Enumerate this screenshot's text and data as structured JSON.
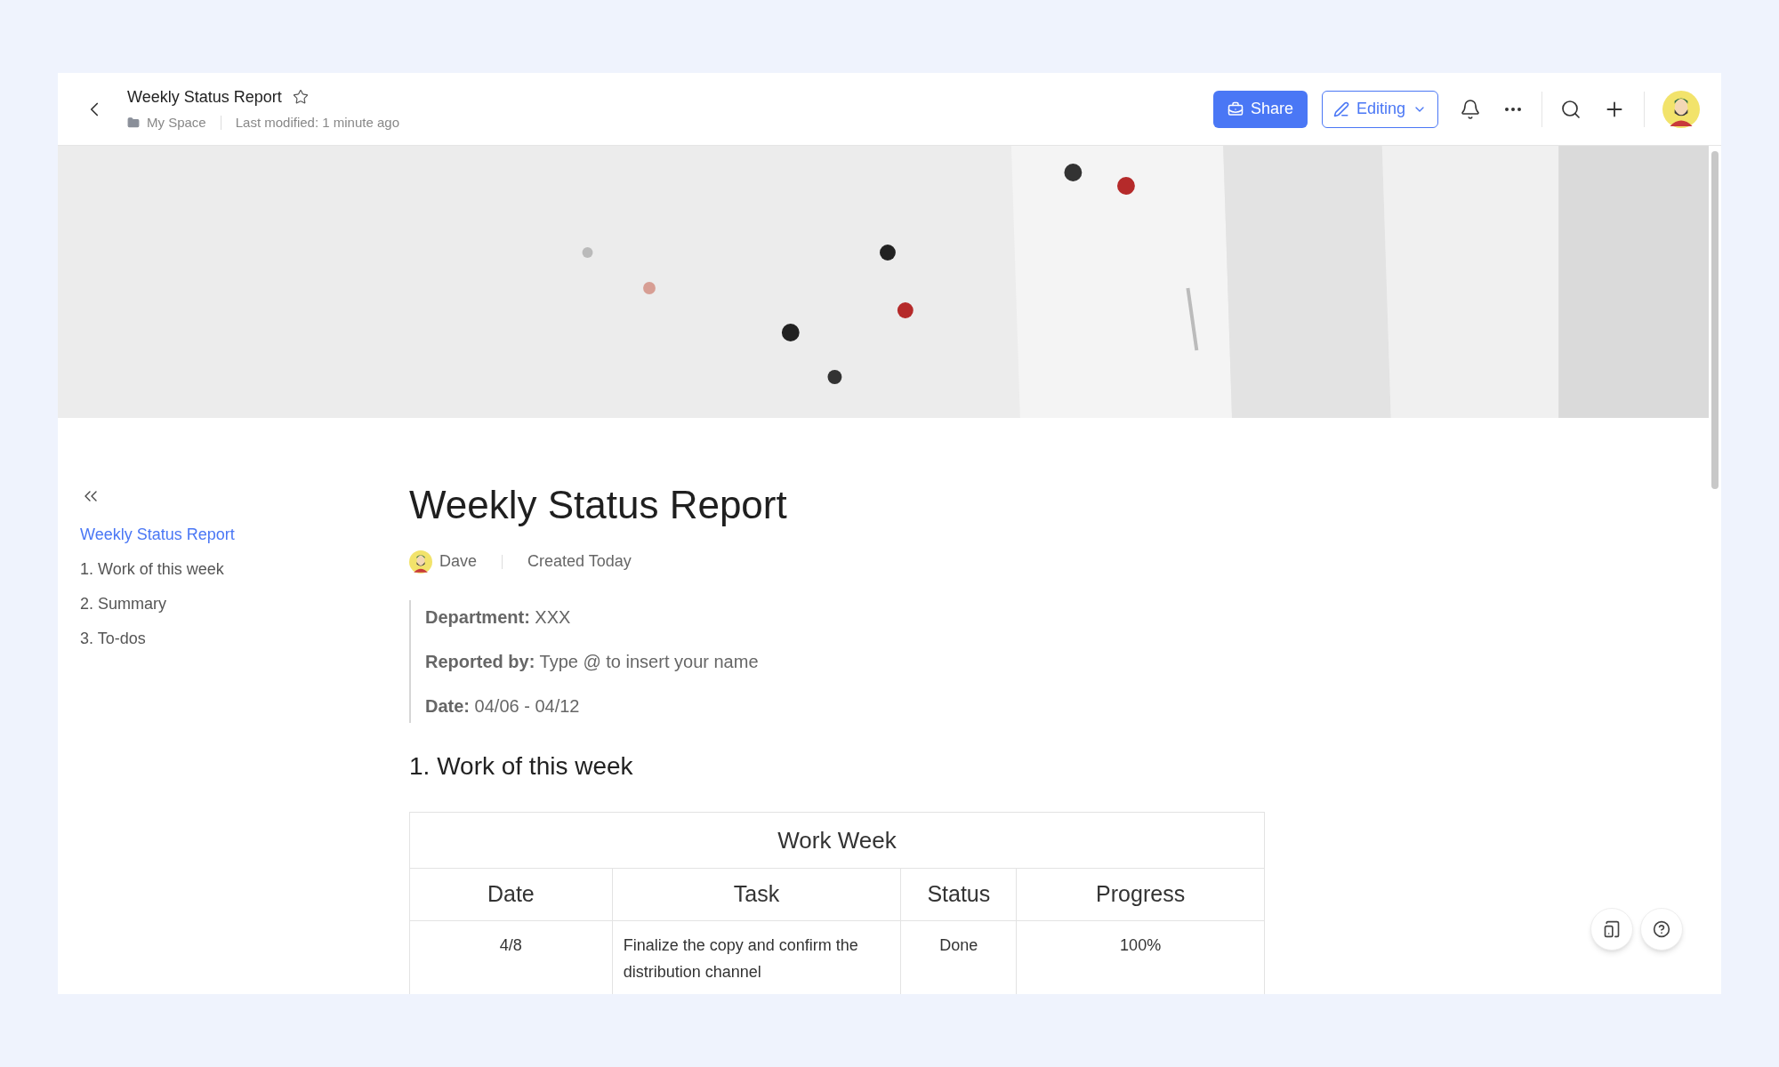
{
  "header": {
    "title": "Weekly Status Report",
    "starred": false,
    "breadcrumb": "My Space",
    "last_modified": "Last modified: 1 minute ago",
    "share": "Share",
    "mode": "Editing"
  },
  "outline": [
    {
      "label": "Weekly Status Report",
      "selected": true
    },
    {
      "label": "1. Work of this week",
      "selected": false
    },
    {
      "label": "2. Summary",
      "selected": false
    },
    {
      "label": "3. To-dos",
      "selected": false
    }
  ],
  "document": {
    "title": "Weekly Status Report",
    "author": "Dave",
    "created": "Created Today",
    "info": [
      "**Department:** XXX",
      "**Reported by:** Type @ to insert your name",
      "**Date:** 04/06 - 04/12"
    ],
    "heading": "1. Work of this week",
    "table": {
      "caption": "Work Week",
      "columns": [
        "Date",
        "Task",
        "Status",
        "Progress"
      ],
      "rows": [
        [
          "4/8",
          "Finalize the copy and confirm the distribution channel",
          "Done",
          "100%"
        ]
      ]
    }
  }
}
